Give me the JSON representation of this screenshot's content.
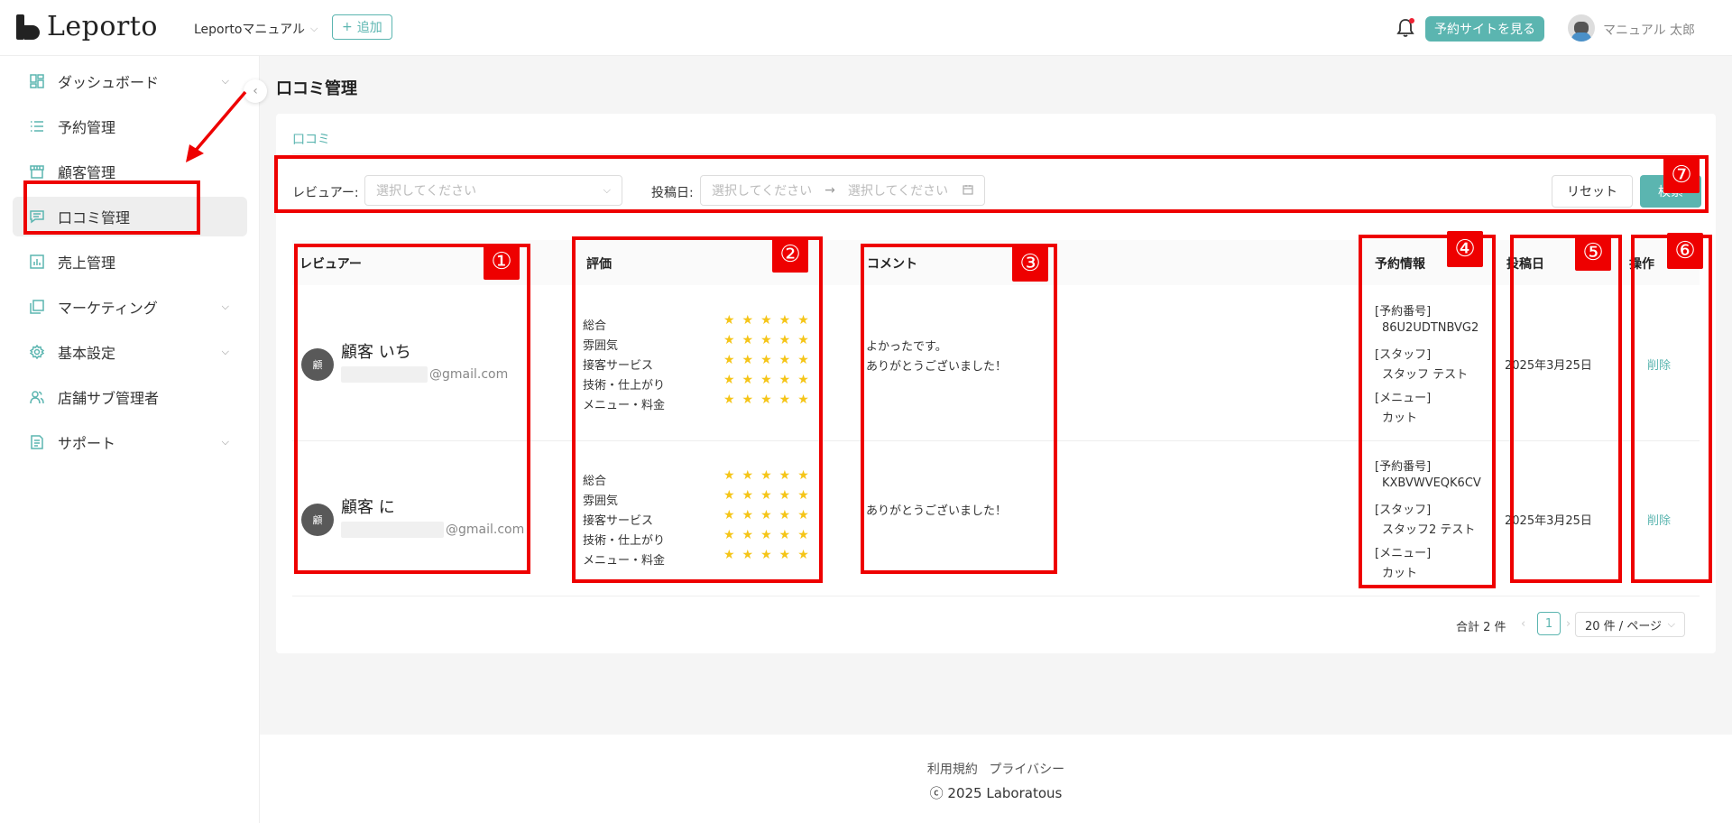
{
  "header": {
    "logo_text": "Leporto",
    "shop_name": "Leportoマニュアル",
    "add_label": "追加",
    "view_site_label": "予約サイトを見る",
    "user_name": "マニュアル 太郎"
  },
  "sidebar": {
    "items": [
      {
        "label": "ダッシュボード",
        "icon": "dashboard-icon",
        "has_chevron": true
      },
      {
        "label": "予約管理",
        "icon": "list-icon",
        "has_chevron": false
      },
      {
        "label": "顧客管理",
        "icon": "store-icon",
        "has_chevron": false
      },
      {
        "label": "口コミ管理",
        "icon": "comment-icon",
        "has_chevron": false,
        "active": true
      },
      {
        "label": "売上管理",
        "icon": "chart-icon",
        "has_chevron": false
      },
      {
        "label": "マーケティング",
        "icon": "copy-icon",
        "has_chevron": true
      },
      {
        "label": "基本設定",
        "icon": "gear-icon",
        "has_chevron": true
      },
      {
        "label": "店舗サブ管理者",
        "icon": "users-icon",
        "has_chevron": false
      },
      {
        "label": "サポート",
        "icon": "report-icon",
        "has_chevron": true
      }
    ]
  },
  "page": {
    "title": "口コミ管理",
    "tab": "口コミ"
  },
  "filters": {
    "reviewer_label": "レビュアー:",
    "reviewer_placeholder": "選択してください",
    "date_label": "投稿日:",
    "date_start_placeholder": "選択してください",
    "date_arrow": "→",
    "date_end_placeholder": "選択してください",
    "reset_label": "リセット",
    "search_label": "検索"
  },
  "table": {
    "headers": {
      "reviewer": "レビュアー",
      "rating": "評価",
      "comment": "コメント",
      "reservation": "予約情報",
      "date": "投稿日",
      "action": "操作"
    },
    "rating_labels": [
      "総合",
      "雰囲気",
      "接客サービス",
      "技術・仕上がり",
      "メニュー・料金"
    ],
    "reservation_labels": {
      "number": "[予約番号]",
      "staff": "[スタッフ]",
      "menu": "[メニュー]"
    },
    "rows": [
      {
        "avatar": "顧",
        "name": "顧客 いち",
        "email_suffix": "@gmail.com",
        "ratings": [
          "★★★★★",
          "★★★★★",
          "★★★★★",
          "★★★★★",
          "★★★★★"
        ],
        "comment_lines": [
          "よかったです。",
          "ありがとうございました！"
        ],
        "reservation_number": "86U2UDTNBVG2",
        "staff": "スタッフ テスト",
        "menu": "カット",
        "date": "2025年3月25日",
        "action": "削除"
      },
      {
        "avatar": "顧",
        "name": "顧客 に",
        "email_suffix": "@gmail.com",
        "ratings": [
          "★★★★★",
          "★★★★★",
          "★★★★★",
          "★★★★★",
          "★★★★★"
        ],
        "comment_lines": [
          "ありがとうございました！"
        ],
        "reservation_number": "KXBVWVEQK6CV",
        "staff": "スタッフ2 テスト",
        "menu": "カット",
        "date": "2025年3月25日",
        "action": "削除"
      }
    ]
  },
  "pagination": {
    "total": "合計 2 件",
    "current": "1",
    "page_size": "20 件 / ページ"
  },
  "footer": {
    "terms": "利用規約",
    "privacy": "プライバシー",
    "copyright": "ⓒ 2025 Laboratous"
  },
  "annotations": [
    "①",
    "②",
    "③",
    "④",
    "⑤",
    "⑥",
    "⑦"
  ],
  "colors": {
    "accent": "#5bb5b0",
    "annotation": "#ee0000",
    "star": "#f5c518"
  }
}
